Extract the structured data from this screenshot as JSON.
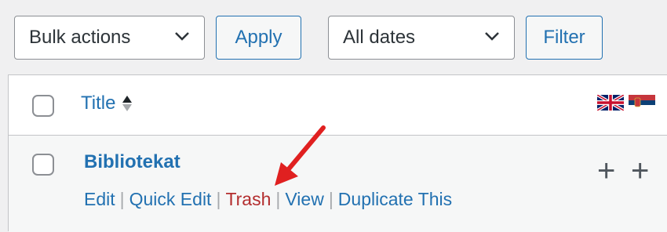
{
  "toolbar": {
    "bulk_actions": {
      "value": "Bulk actions"
    },
    "apply_label": "Apply",
    "dates": {
      "value": "All dates"
    },
    "filter_label": "Filter"
  },
  "table": {
    "columns": [
      {
        "label": "Title"
      }
    ],
    "language_flags": [
      "en-gb-flag",
      "sr-flag"
    ],
    "rows": [
      {
        "title": "Bibliotekat",
        "actions": {
          "edit": "Edit",
          "quick_edit": "Quick Edit",
          "trash": "Trash",
          "view": "View",
          "duplicate": "Duplicate This"
        },
        "add_translation_icons": [
          "plus-icon",
          "plus-icon"
        ]
      }
    ]
  },
  "annotation": {
    "arrow_color": "#e02020"
  }
}
